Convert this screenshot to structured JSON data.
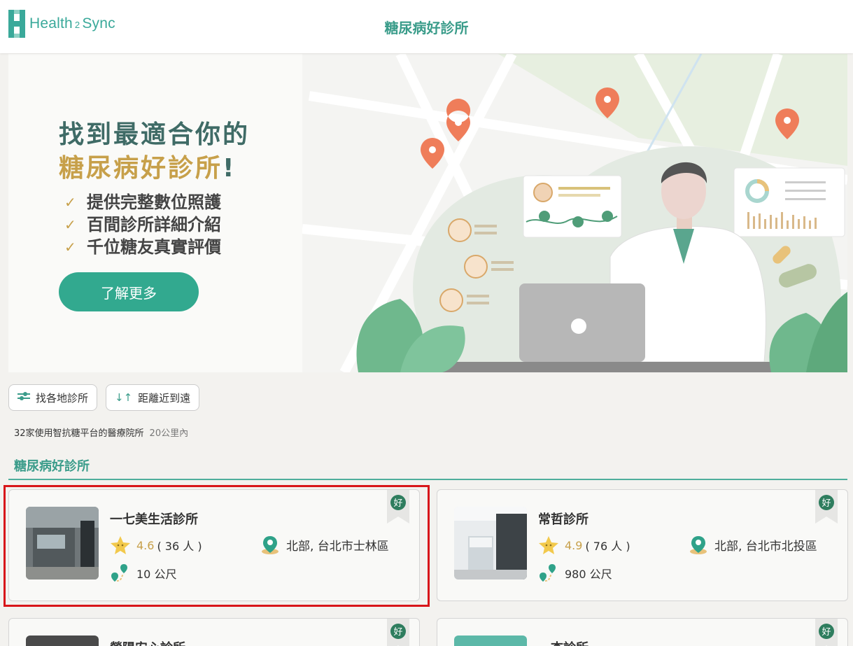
{
  "header": {
    "logo_text_a": "Health",
    "logo_text_b": "2",
    "logo_text_c": "Sync",
    "title": "糖尿病好診所"
  },
  "hero": {
    "line1": "找到最適合你的",
    "line2": "糖尿病好診所",
    "line2_suffix": "!",
    "features": [
      "提供完整數位照護",
      "百間診所詳細介紹",
      "千位糖友真實評價"
    ],
    "cta": "了解更多"
  },
  "filters": {
    "region": "找各地診所",
    "sort": "距離近到遠"
  },
  "summary": {
    "count_text": "32家使用智抗糖平台的醫療院所",
    "radius": "20公里內"
  },
  "section_title": "糖尿病好診所",
  "badge_text": "好",
  "clinics": [
    {
      "name": "一七美生活診所",
      "rating": "4.6",
      "reviews": "( 36 人 )",
      "region": "北部, 台北市士林區",
      "distance": "10 公尺"
    },
    {
      "name": "常哲診所",
      "rating": "4.9",
      "reviews": "( 76 人 )",
      "region": "北部, 台北市北投區",
      "distance": "980 公尺"
    },
    {
      "name": "榮陽安心診所",
      "rating": "",
      "reviews": "",
      "region": "",
      "distance": ""
    },
    {
      "name": "一杏診所",
      "rating": "",
      "reviews": "",
      "region": "",
      "distance": ""
    }
  ],
  "colors": {
    "brand": "#3aa99a",
    "accent_gold": "#c7a04a",
    "cta": "#32a98f",
    "highlight": "#d8161a"
  }
}
